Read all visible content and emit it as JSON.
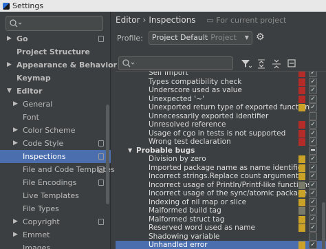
{
  "window": {
    "title": "Settings",
    "app_icon": "intellij-app-icon"
  },
  "sidebar": {
    "search_placeholder": "",
    "items": [
      {
        "label": "Go",
        "level": 0,
        "arrow": "right",
        "bold": true,
        "project_icon": true
      },
      {
        "label": "Project Structure",
        "level": 0,
        "arrow": "",
        "bold": true,
        "project_icon": false
      },
      {
        "label": "Appearance & Behavior",
        "level": 0,
        "arrow": "right",
        "bold": true,
        "project_icon": false
      },
      {
        "label": "Keymap",
        "level": 0,
        "arrow": "",
        "bold": true,
        "project_icon": false
      },
      {
        "label": "Editor",
        "level": 0,
        "arrow": "down",
        "bold": true,
        "project_icon": false
      },
      {
        "label": "General",
        "level": 1,
        "arrow": "right",
        "bold": false,
        "project_icon": false
      },
      {
        "label": "Font",
        "level": 1,
        "arrow": "",
        "bold": false,
        "project_icon": false
      },
      {
        "label": "Color Scheme",
        "level": 1,
        "arrow": "right",
        "bold": false,
        "project_icon": false
      },
      {
        "label": "Code Style",
        "level": 1,
        "arrow": "right",
        "bold": false,
        "project_icon": true
      },
      {
        "label": "Inspections",
        "level": 1,
        "arrow": "",
        "bold": false,
        "project_icon": true,
        "selected": true
      },
      {
        "label": "File and Code Templates",
        "level": 1,
        "arrow": "",
        "bold": false,
        "project_icon": true
      },
      {
        "label": "File Encodings",
        "level": 1,
        "arrow": "",
        "bold": false,
        "project_icon": true
      },
      {
        "label": "Live Templates",
        "level": 1,
        "arrow": "",
        "bold": false,
        "project_icon": false
      },
      {
        "label": "File Types",
        "level": 1,
        "arrow": "",
        "bold": false,
        "project_icon": false
      },
      {
        "label": "Copyright",
        "level": 1,
        "arrow": "right",
        "bold": false,
        "project_icon": true
      },
      {
        "label": "Emmet",
        "level": 1,
        "arrow": "right",
        "bold": false,
        "project_icon": false
      },
      {
        "label": "Images",
        "level": 1,
        "arrow": "",
        "bold": false,
        "project_icon": false
      }
    ]
  },
  "main": {
    "breadcrumb": {
      "section": "Editor",
      "separator": "›",
      "page": "Inspections",
      "scope": "For current project"
    },
    "profile": {
      "label": "Profile:",
      "value": "Project Default",
      "scope": "Project"
    },
    "inspections_search_placeholder": "",
    "colors": {
      "error": "#b52b27",
      "warning": "#c9a227",
      "weak_warning": "#7a7a6a",
      "selection": "#4b6eaf"
    },
    "rows": [
      {
        "label": "Self import",
        "group": false,
        "severity": "error",
        "checked": true,
        "indent": 2
      },
      {
        "label": "Types compatibility check",
        "group": false,
        "severity": "error",
        "checked": true,
        "indent": 2
      },
      {
        "label": "Underscore used as value",
        "group": false,
        "severity": "error",
        "checked": true,
        "indent": 2
      },
      {
        "label": "Unexpected '~'",
        "group": false,
        "severity": "error",
        "checked": true,
        "indent": 2
      },
      {
        "label": "Unexported return type of exported function",
        "group": false,
        "severity": "warning",
        "checked": true,
        "indent": 2
      },
      {
        "label": "Unnecessarily exported identifier",
        "group": false,
        "severity": "none",
        "checked": false,
        "indent": 2
      },
      {
        "label": "Unresolved reference",
        "group": false,
        "severity": "error",
        "checked": true,
        "indent": 2
      },
      {
        "label": "Usage of cgo in tests is not supported",
        "group": false,
        "severity": "error",
        "checked": true,
        "indent": 2
      },
      {
        "label": "Wrong test declaration",
        "group": false,
        "severity": "error",
        "checked": true,
        "indent": 2
      },
      {
        "label": "Probable bugs",
        "group": true,
        "severity": "none",
        "checked": "partial",
        "indent": 1
      },
      {
        "label": "Division by zero",
        "group": false,
        "severity": "warning",
        "checked": true,
        "indent": 2
      },
      {
        "label": "Imported package name as name identifier",
        "group": false,
        "severity": "warning",
        "checked": true,
        "indent": 2
      },
      {
        "label": "Incorrect strings.Replace count argument",
        "group": false,
        "severity": "warning",
        "checked": true,
        "indent": 2
      },
      {
        "label": "Incorrect usage of Println/Printf-like functions",
        "group": false,
        "severity": "weak_warning",
        "checked": true,
        "indent": 2
      },
      {
        "label": "Incorrect usage of the sync/atomic package",
        "group": false,
        "severity": "warning",
        "checked": true,
        "indent": 2
      },
      {
        "label": "Indexing of nil map or slice",
        "group": false,
        "severity": "warning",
        "checked": true,
        "indent": 2
      },
      {
        "label": "Malformed build tag",
        "group": false,
        "severity": "weak_warning",
        "checked": true,
        "indent": 2
      },
      {
        "label": "Malformed struct tag",
        "group": false,
        "severity": "warning",
        "checked": true,
        "indent": 2
      },
      {
        "label": "Reserved word used as name",
        "group": false,
        "severity": "warning",
        "checked": true,
        "indent": 2
      },
      {
        "label": "Shadowing variable",
        "group": false,
        "severity": "none",
        "checked": false,
        "indent": 2
      },
      {
        "label": "Unhandled error",
        "group": false,
        "severity": "warning",
        "checked": true,
        "indent": 2,
        "selected": true
      }
    ]
  }
}
